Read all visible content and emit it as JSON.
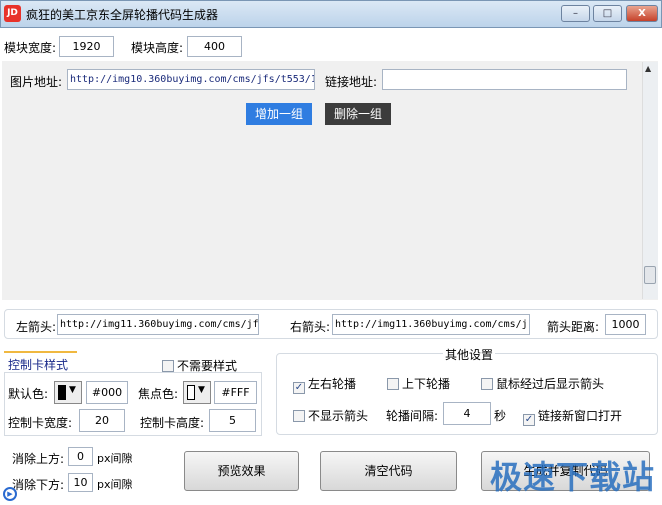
{
  "window": {
    "title": "疯狂的美工京东全屏轮播代码生成器",
    "logo": "JD",
    "minimize": "–",
    "maximize": "□",
    "close": "X"
  },
  "module": {
    "width_label": "模块宽度:",
    "width": "1920",
    "height_label": "模块高度:",
    "height": "400"
  },
  "group": {
    "image_label": "图片地址:",
    "image_url": "http://img10.360buyimg.com/cms/jfs/t553/1",
    "link_label": "链接地址:",
    "link_url": "",
    "add": "增加一组",
    "delete": "删除一组"
  },
  "arrows": {
    "left_label": "左箭头:",
    "left_url": "http://img11.360buyimg.com/cms/jfs",
    "right_label": "右箭头:",
    "right_url": "http://img11.360buyimg.com/cms/j:",
    "distance_label": "箭头距离:",
    "distance": "1000"
  },
  "control": {
    "tab": "控制卡样式",
    "no_style": "不需要样式",
    "no_style_checked": false,
    "default_color_label": "默认色:",
    "default_color": "#000",
    "focus_color_label": "焦点色:",
    "focus_color": "#FFF",
    "width_label": "控制卡宽度:",
    "width": "20",
    "height_label": "控制卡高度:",
    "height": "5"
  },
  "other": {
    "title": "其他设置",
    "lr": "左右轮播",
    "lr_checked": true,
    "ud": "上下轮播",
    "ud_checked": false,
    "hover_arrow": "鼠标经过后显示箭头",
    "hover_checked": false,
    "hide_arrow": "不显示箭头",
    "hide_checked": false,
    "interval_label": "轮播间隔:",
    "interval": "4",
    "interval_unit": "秒",
    "new_window": "链接新窗口打开",
    "new_window_checked": true
  },
  "gap": {
    "top_label": "消除上方:",
    "top": "0",
    "bottom_label": "消除下方:",
    "bottom": "10",
    "unit": "px间隙"
  },
  "buttons": {
    "preview": "预览效果",
    "clear": "清空代码",
    "generate": "生成并复制代码"
  },
  "watermark": "极速下载站",
  "colors": {
    "accent": "#2f7de1",
    "dark_button": "#3c3c3c",
    "tab_underline": "#f0b840"
  }
}
